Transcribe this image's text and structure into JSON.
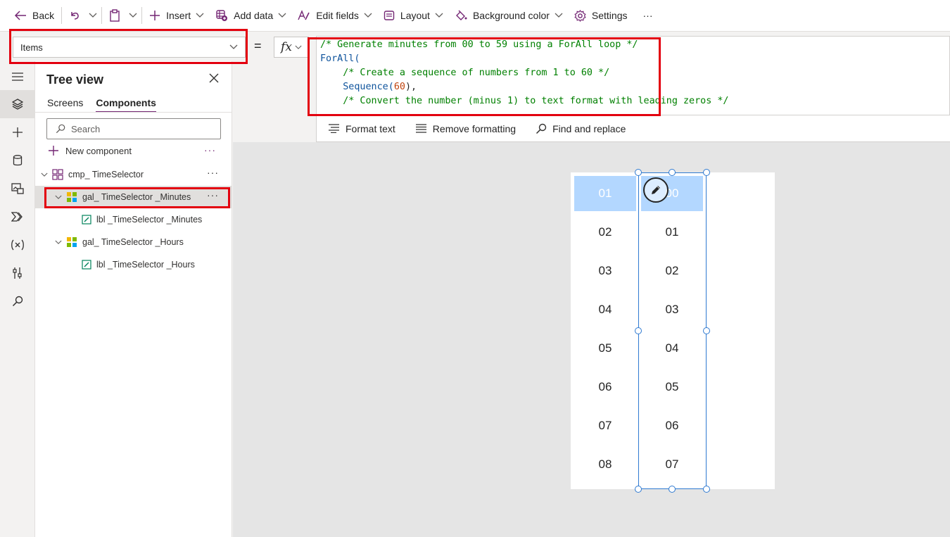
{
  "toolbar": {
    "back": "Back",
    "insert": "Insert",
    "add_data": "Add data",
    "edit_fields": "Edit fields",
    "layout": "Layout",
    "background_color": "Background color",
    "settings": "Settings",
    "more": "···"
  },
  "formula": {
    "property": "Items",
    "equals": "=",
    "fx": "fx",
    "code_lines": [
      "/* Generate minutes from 00 to 59 using a ForAll loop */",
      "ForAll(",
      "    /* Create a sequence of numbers from 1 to 60 */",
      "    Sequence(60),",
      "",
      "    /* Convert the number (minus 1) to text format with leading zeros */"
    ],
    "code_tokens": {
      "seq_fn": "Sequence(",
      "seq_num": "60",
      "seq_end": "),"
    }
  },
  "format_bar": {
    "format_text": "Format text",
    "remove_formatting": "Remove formatting",
    "find_replace": "Find and replace"
  },
  "tree": {
    "title": "Tree view",
    "tabs": [
      "Screens",
      "Components"
    ],
    "active_tab": "Components",
    "search_placeholder": "Search",
    "new_component": "New component",
    "more": "···",
    "nodes": [
      {
        "label": "cmp_ TimeSelector"
      },
      {
        "label": "gal_ TimeSelector _Minutes"
      },
      {
        "label": "lbl _TimeSelector _Minutes"
      },
      {
        "label": "gal_ TimeSelector _Hours"
      },
      {
        "label": "lbl _TimeSelector _Hours"
      }
    ]
  },
  "canvas": {
    "hours_column": [
      "01",
      "02",
      "03",
      "04",
      "05",
      "06",
      "07",
      "08"
    ],
    "minutes_column": [
      "00",
      "01",
      "02",
      "03",
      "04",
      "05",
      "06",
      "07"
    ],
    "selected_hour": "01",
    "selected_minute": "00",
    "highlight_color": "#b3d7ff"
  },
  "colors": {
    "accent": "#742774",
    "selection": "#2f7ad1",
    "annotation": "#e3000f",
    "comment": "#008000",
    "function": "#0e539c",
    "number": "#c1440e"
  }
}
